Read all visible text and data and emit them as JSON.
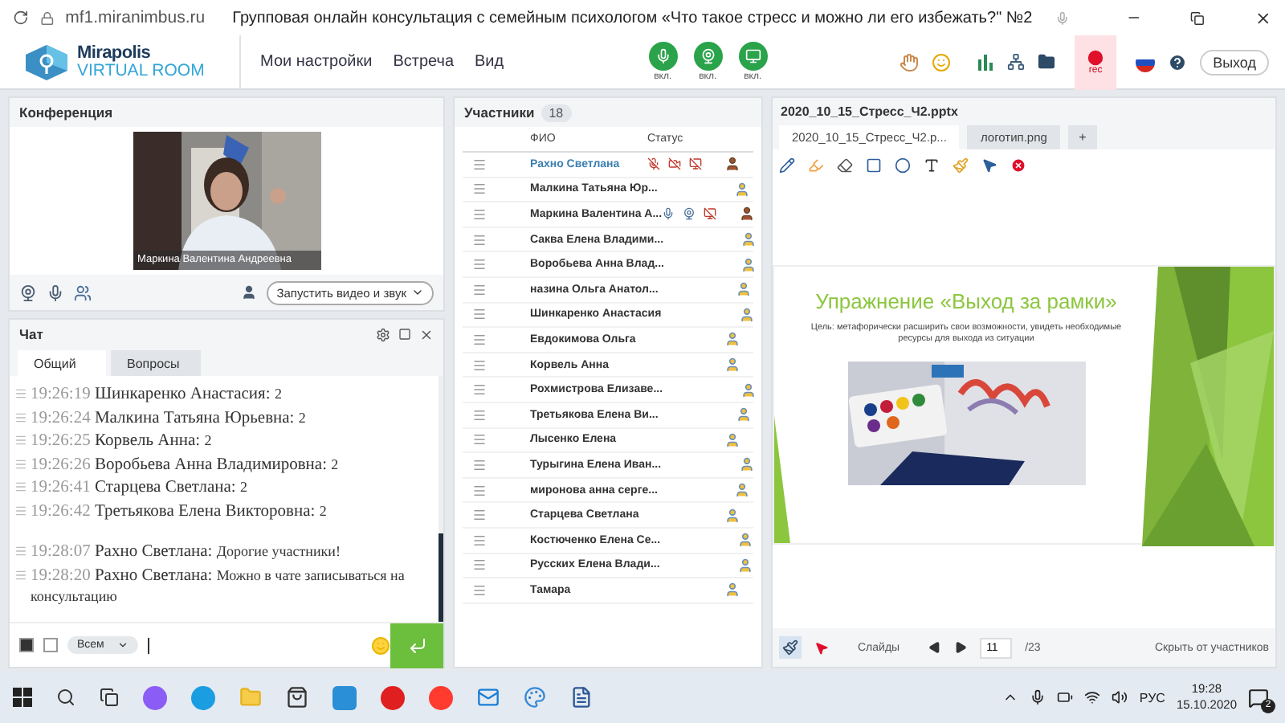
{
  "browser": {
    "url": "mf1.miranimbus.ru",
    "title": "Групповая онлайн консультация с семейным психологом «Что такое стресс и можно ли его избежать?\" №2"
  },
  "header": {
    "logo_top": "Mirapolis",
    "logo_bottom": "VIRTUAL ROOM",
    "menu": [
      "Мои настройки",
      "Встреча",
      "Вид"
    ],
    "media": [
      {
        "kind": "mic",
        "label": "вкл."
      },
      {
        "kind": "camera",
        "label": "вкл."
      },
      {
        "kind": "screen",
        "label": "вкл."
      }
    ],
    "rec_label": "rec",
    "exit": "Выход"
  },
  "conference": {
    "title": "Конференция",
    "video_caption": "Маркина Валентина  Андреевна",
    "start_button": "Запустить видео и звук"
  },
  "chat": {
    "title": "Чат",
    "tabs": [
      {
        "label": "Общий",
        "selected": true
      },
      {
        "label": "Вопросы",
        "selected": false
      }
    ],
    "messages": [
      {
        "time": "19:26:19",
        "author": "Шинкаренко  Анастасия:",
        "text": "2"
      },
      {
        "time": "19:26:24",
        "author": "Малкина Татьяна  Юрьевна:",
        "text": "2"
      },
      {
        "time": "19:26:25",
        "author": "Корвель Анна:",
        "text": "2"
      },
      {
        "time": "19:26:26",
        "author": "Воробьева Анна  Владимировна:",
        "text": "2"
      },
      {
        "time": "19:26:41",
        "author": "Старцева Светлана:",
        "text": "2"
      },
      {
        "time": "19:26:42",
        "author": "Третьякова  Елена Викторовна:",
        "text": "2"
      },
      {
        "time": "19:28:07",
        "author": "Рахно Светлана:",
        "text": "Дорогие участники!"
      },
      {
        "time": "19:28:20",
        "author": "Рахно Светлана:",
        "text": "Можно в чате записываться на консультацию"
      }
    ],
    "recipient": "Всем"
  },
  "participants": {
    "title": "Участники",
    "count": "18",
    "columns": [
      "ФИО",
      "Статус"
    ],
    "rows": [
      {
        "name": "Рахно Светлана",
        "selected": true,
        "kind": "presenter",
        "devices": [
          {
            "kind": "mic",
            "on": false
          },
          {
            "kind": "camera",
            "on": false
          },
          {
            "kind": "screen",
            "on": false
          }
        ]
      },
      {
        "name": "Малкина Татьяна  Юр...",
        "selected": false,
        "kind": "listener"
      },
      {
        "name": "Маркина Валентина  А...",
        "selected": false,
        "kind": "presenter",
        "devices": [
          {
            "kind": "mic",
            "on": true
          },
          {
            "kind": "camera",
            "on": true
          },
          {
            "kind": "screen",
            "on": false
          }
        ]
      },
      {
        "name": "Саква Елена Владими...",
        "selected": false,
        "kind": "listener"
      },
      {
        "name": "Воробьева Анна  Влад...",
        "selected": false,
        "kind": "listener"
      },
      {
        "name": "назина  Ольга Анатол...",
        "selected": false,
        "kind": "listener"
      },
      {
        "name": "Шинкаренко  Анастасия",
        "selected": false,
        "kind": "listener"
      },
      {
        "name": "Евдокимова Ольга",
        "selected": false,
        "kind": "listener"
      },
      {
        "name": "Корвель Анна",
        "selected": false,
        "kind": "listener"
      },
      {
        "name": "Рохмистрова  Елизаве...",
        "selected": false,
        "kind": "listener"
      },
      {
        "name": "Третьякова  Елена Ви...",
        "selected": false,
        "kind": "listener"
      },
      {
        "name": "Лысенко Елена",
        "selected": false,
        "kind": "listener"
      },
      {
        "name": "Турыгина  Елена  Иван...",
        "selected": false,
        "kind": "listener"
      },
      {
        "name": "миронова  анна  серге...",
        "selected": false,
        "kind": "listener"
      },
      {
        "name": "Старцева Светлана",
        "selected": false,
        "kind": "listener"
      },
      {
        "name": "Костюченко  Елена Се...",
        "selected": false,
        "kind": "listener"
      },
      {
        "name": "Русских Елена Влади...",
        "selected": false,
        "kind": "listener"
      },
      {
        "name": "Тамара",
        "selected": false,
        "kind": "listener"
      }
    ]
  },
  "presentation": {
    "file": "2020_10_15_Стресс_Ч2.pptx",
    "tabs": [
      {
        "label": "2020_10_15_Стресс_Ч2.p...",
        "selected": true
      },
      {
        "label": "логотип.png",
        "selected": false
      }
    ],
    "add_tab": "+",
    "slide": {
      "title": "Упражнение «Выход за рамки»",
      "text": "Цель: метафорически расширить свои возможности, увидеть необходимые ресурсы для выхода из ситуации"
    },
    "footer": {
      "slides_label": "Слайды",
      "page": "11",
      "total": "/23",
      "hide": "Скрыть от участников"
    }
  },
  "taskbar": {
    "lang": "РУС",
    "time": "19:28",
    "date": "15.10.2020",
    "notifications": "2"
  }
}
